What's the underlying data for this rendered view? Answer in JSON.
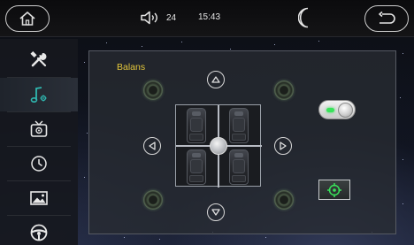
{
  "statusbar": {
    "volume": "24",
    "time": "15:43"
  },
  "sidebar": {
    "items": [
      {
        "icon": "tools-icon",
        "active": false
      },
      {
        "icon": "music-settings-icon",
        "active": true
      },
      {
        "icon": "tv-settings-icon",
        "active": false
      },
      {
        "icon": "clock-icon",
        "active": false
      },
      {
        "icon": "picture-icon",
        "active": false
      },
      {
        "icon": "steering-wheel-icon",
        "active": false
      }
    ]
  },
  "balance": {
    "title": "Balans",
    "toggle_on": true
  },
  "colors": {
    "title": "#e3c63b",
    "accent_green": "#39e35a",
    "active_icon": "#2fb7b0"
  }
}
